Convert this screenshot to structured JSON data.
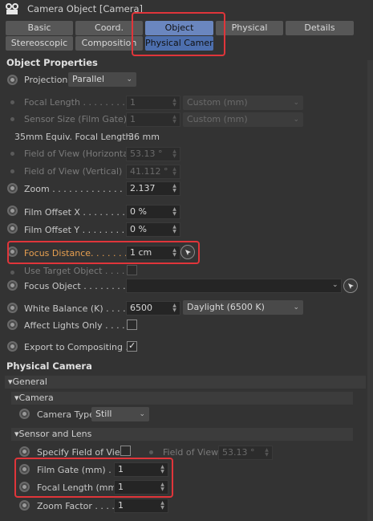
{
  "window": {
    "title": "Camera Object [Camera]"
  },
  "tabs_row1": [
    {
      "label": "Basic"
    },
    {
      "label": "Coord."
    },
    {
      "label": "Object"
    },
    {
      "label": "Physical"
    },
    {
      "label": "Details"
    }
  ],
  "tabs_row2": [
    {
      "label": "Stereoscopic"
    },
    {
      "label": "Composition"
    },
    {
      "label": "Physical Camera"
    }
  ],
  "object_properties": {
    "title": "Object Properties",
    "projection": {
      "label": "Projection",
      "value": "Parallel"
    },
    "focal_length": {
      "label": "Focal Length . . . . . . . .",
      "value": "1",
      "preset": "Custom (mm)"
    },
    "sensor_size": {
      "label": "Sensor Size (Film Gate)",
      "value": "1",
      "preset": "Custom (mm)"
    },
    "equiv_focal": {
      "label": "35mm Equiv. Focal Length:",
      "value": "36 mm"
    },
    "fov_h": {
      "label": "Field of View (Horizontal)",
      "value": "53.13 °"
    },
    "fov_v": {
      "label": "Field of View (Vertical) . .",
      "value": "41.112 °"
    },
    "zoom": {
      "label": "Zoom . . . . . . . . . . . . .",
      "value": "2.137"
    },
    "film_offset_x": {
      "label": "Film Offset X . . . . . . . .",
      "value": "0 %"
    },
    "film_offset_y": {
      "label": "Film Offset Y . . . . . . . .",
      "value": "0 %"
    },
    "focus_distance": {
      "label": "Focus Distance. . . . . . . .",
      "value": "1 cm"
    },
    "use_target": {
      "label": "Use Target Object . . . . . ."
    },
    "focus_object": {
      "label": "Focus Object . . . . . . . ."
    },
    "white_balance": {
      "label": "White Balance (K) . . . . .",
      "value": "6500",
      "preset": "Daylight (6500 K)"
    },
    "affect_lights": {
      "label": "Affect Lights Only . . . . ."
    },
    "export_comp": {
      "label": "Export to Compositing ."
    }
  },
  "physical_camera": {
    "title": "Physical Camera",
    "general_label": "General",
    "camera_group_label": "Camera",
    "camera_type": {
      "label": "Camera Type",
      "value": "Still"
    },
    "sensor_group_label": "Sensor and Lens",
    "specify_fov": {
      "label": "Specify Field of View"
    },
    "fov": {
      "label": "Field of View",
      "value": "53.13 °"
    },
    "film_gate": {
      "label": "Film Gate (mm) . .",
      "value": "1"
    },
    "focal_length": {
      "label": "Focal Length (mm)",
      "value": "1"
    },
    "zoom_factor": {
      "label": "Zoom Factor . . . . .",
      "value": "1"
    }
  },
  "colors": {
    "accent_tab": "#6a86bf",
    "highlight_box": "#e0353a",
    "focus_label": "#e8a050"
  }
}
